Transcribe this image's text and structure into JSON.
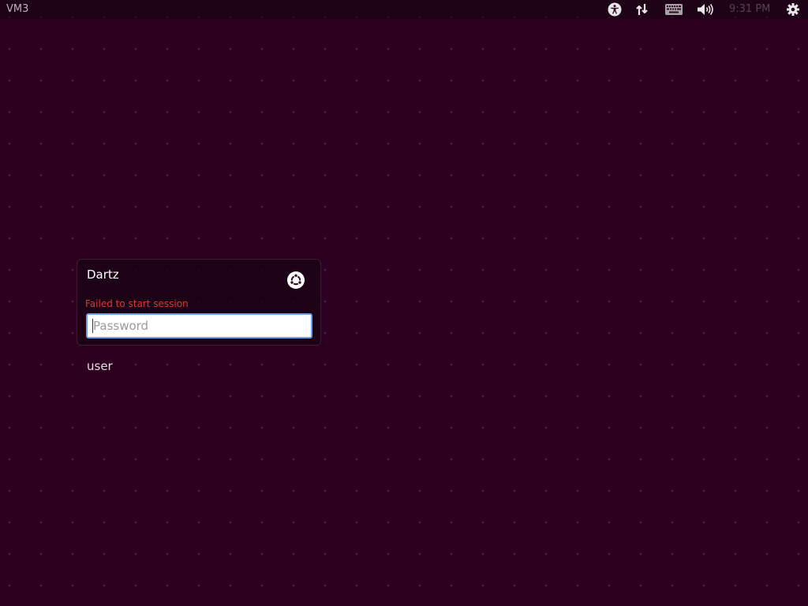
{
  "panel": {
    "hostname": "VM3",
    "clock": "9:31 PM",
    "indicators": [
      {
        "name": "accessibility-icon"
      },
      {
        "name": "network-icon"
      },
      {
        "name": "keyboard-icon"
      },
      {
        "name": "volume-icon"
      },
      {
        "name": "power-gear-icon"
      }
    ]
  },
  "login": {
    "selected_user": "Dartz",
    "session_icon": "ubuntu-session-icon",
    "error_message": "Failed to start session",
    "password_placeholder": "Password",
    "password_value": ""
  },
  "users": [
    {
      "name": "user"
    }
  ],
  "colors": {
    "background": "#2c001e",
    "error": "#df382c",
    "focus_border": "#6a9ee7"
  }
}
